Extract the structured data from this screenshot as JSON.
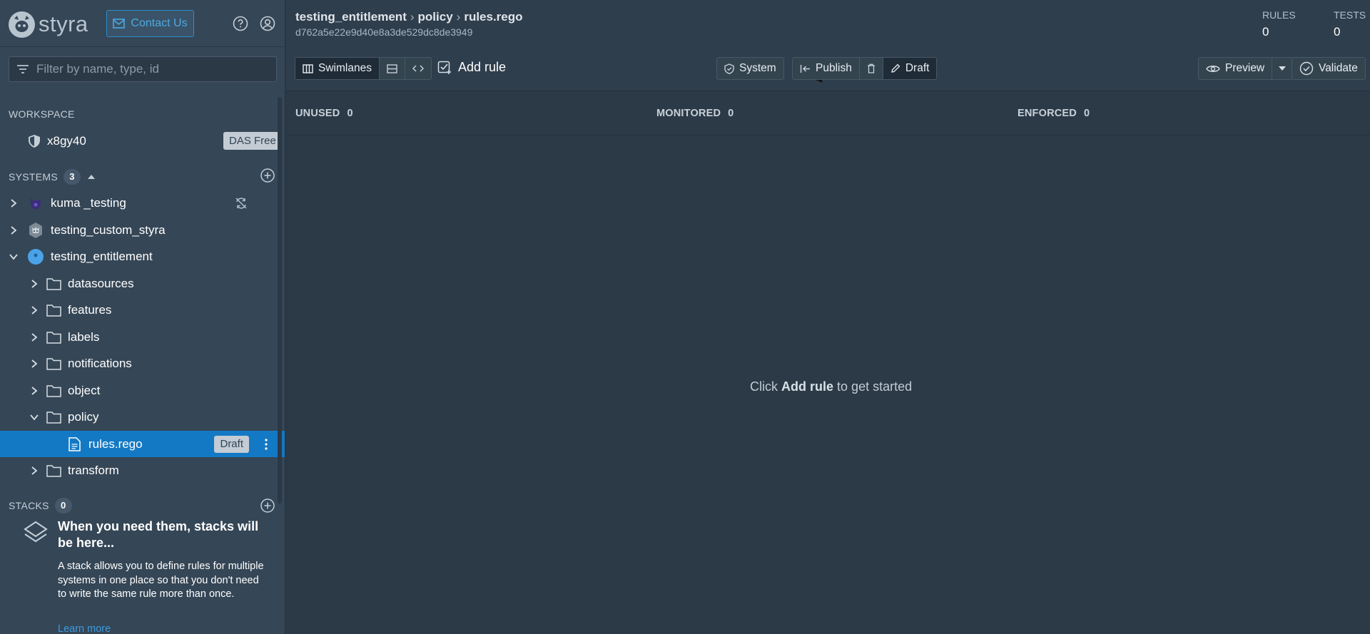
{
  "sidebar": {
    "logo_text": "styra",
    "contact_label": "Contact Us",
    "filter_placeholder": "Filter by name, type, id",
    "workspace": {
      "label": "WORKSPACE",
      "name": "x8gy40",
      "plan_badge": "DAS Free"
    },
    "systems": {
      "label": "SYSTEMS",
      "count": "3",
      "items": [
        {
          "label": "kuma _testing"
        },
        {
          "label": "testing_custom_styra"
        },
        {
          "label": "testing_entitlement"
        }
      ],
      "folders": [
        {
          "label": "datasources"
        },
        {
          "label": "features"
        },
        {
          "label": "labels"
        },
        {
          "label": "notifications"
        },
        {
          "label": "object"
        },
        {
          "label": "policy"
        },
        {
          "label": "transform"
        }
      ],
      "file": {
        "label": "rules.rego",
        "badge": "Draft"
      }
    },
    "stacks": {
      "label": "STACKS",
      "count": "0",
      "empty_title": "When you need them, stacks will be here...",
      "empty_desc": "A stack allows you to define rules for multiple systems in one place so that you don't need to write the same rule more than once.",
      "learn_more": "Learn more"
    }
  },
  "header": {
    "breadcrumb": [
      "testing_entitlement",
      "policy",
      "rules.rego"
    ],
    "breadcrumb_sep": "›",
    "hash": "d762a5e22e9d40e8a3de529dc8de3949",
    "rules_label": "RULES",
    "rules_value": "0",
    "tests_label": "TESTS",
    "tests_value": "0"
  },
  "toolbar": {
    "swimlanes_label": "Swimlanes",
    "add_rule_label": "Add rule",
    "system_label": "System",
    "publish_label": "Publish",
    "draft_label": "Draft",
    "preview_label": "Preview",
    "validate_label": "Validate"
  },
  "swimlanes": {
    "columns": [
      {
        "label": "UNUSED",
        "count": "0"
      },
      {
        "label": "MONITORED",
        "count": "0"
      },
      {
        "label": "ENFORCED",
        "count": "0"
      }
    ]
  },
  "empty_state": {
    "prefix": "Click",
    "emphasis": "Add rule",
    "suffix": "to get started"
  },
  "colors": {
    "accent": "#1479c4",
    "annotation_arrow": "#e01b1b"
  }
}
